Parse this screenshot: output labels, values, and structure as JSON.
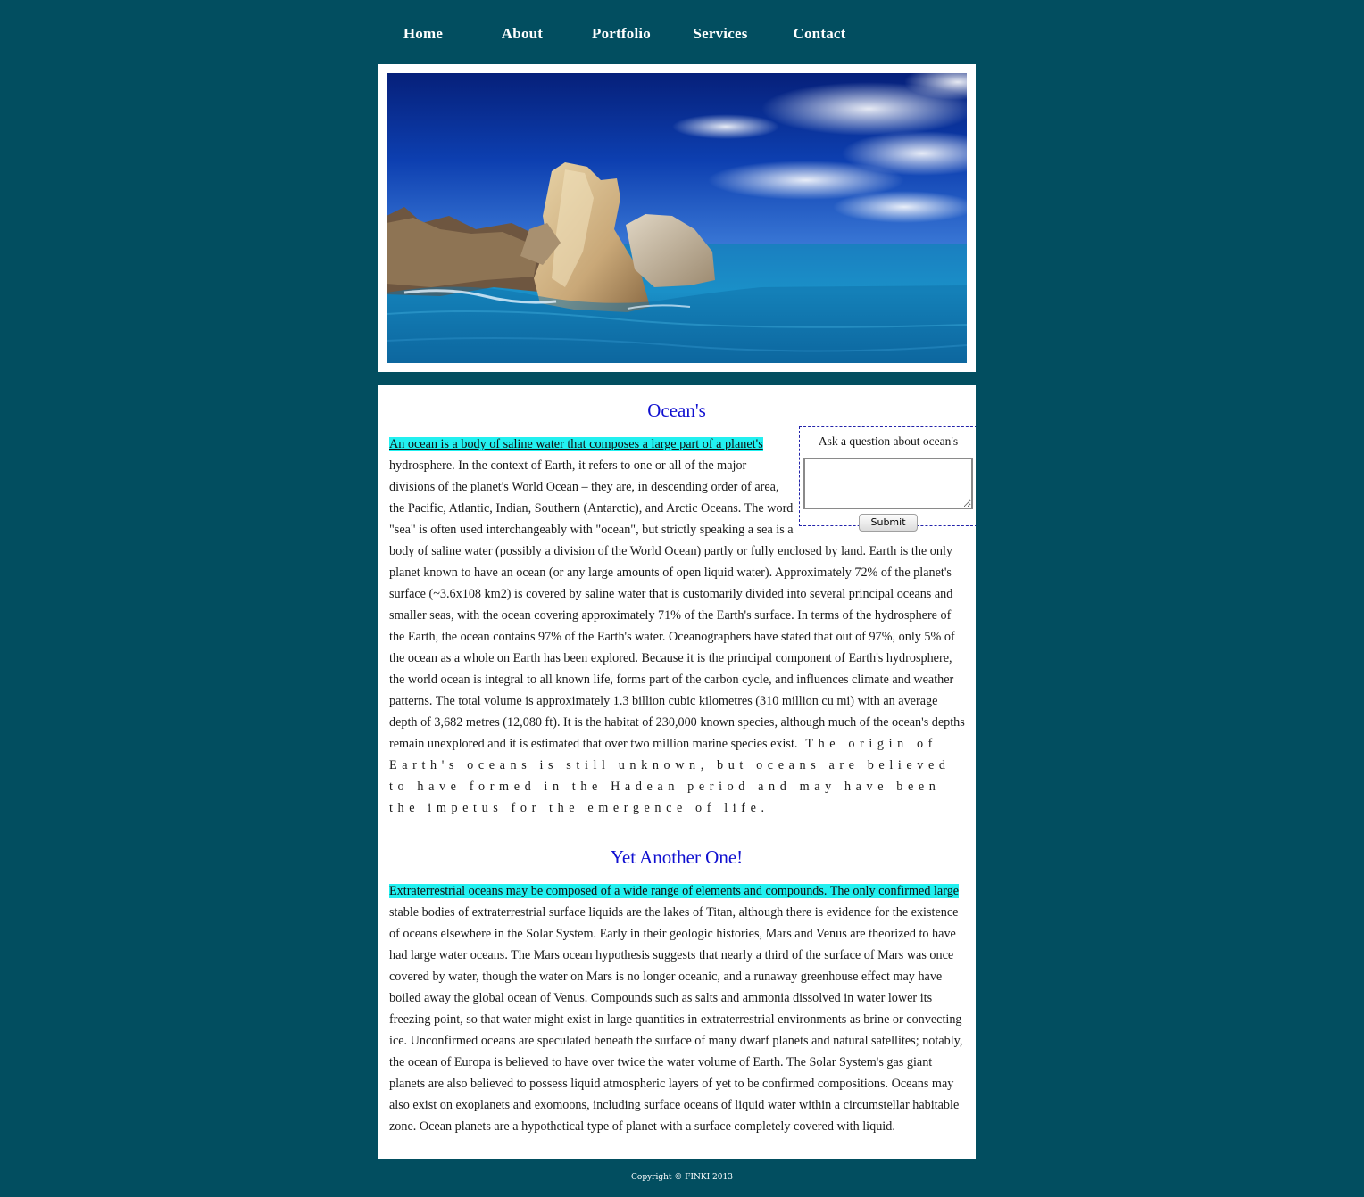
{
  "nav": {
    "items": [
      "Home",
      "About",
      "Portfolio",
      "Services",
      "Contact"
    ]
  },
  "hero": {
    "sky_color": "#0a2a8c",
    "sea_color": "#1570a8"
  },
  "section1": {
    "title": "Ocean's",
    "highlight": "An ocean is a body of saline water that composes a large part of a planet's",
    "body": " hydrosphere. In the context of Earth, it refers to one or all of the major divisions of the planet's World Ocean – they are, in descending order of area, the Pacific, Atlantic, Indian, Southern (Antarctic), and Arctic Oceans. The word \"sea\" is often used interchangeably with \"ocean\", but strictly speaking a sea is a body of saline water (possibly a division of the World Ocean) partly or fully enclosed by land. Earth is the only planet known to have an ocean (or any large amounts of open liquid water). Approximately 72% of the planet's surface (~3.6x108 km2) is covered by saline water that is customarily divided into several principal oceans and smaller seas, with the ocean covering approximately 71% of the Earth's surface. In terms of the hydrosphere of the Earth, the ocean contains 97% of the Earth's water. Oceanographers have stated that out of 97%, only 5% of the ocean as a whole on Earth has been explored. Because it is the principal component of Earth's hydrosphere, the world ocean is integral to all known life, forms part of the carbon cycle, and influences climate and weather patterns. The total volume is approximately 1.3 billion cubic kilometres (310 million cu mi) with an average depth of 3,682 metres (12,080 ft). It is the habitat of 230,000 known species, although much of the ocean's depths remain unexplored and it is estimated that over two million marine species exist.",
    "spaced": " The origin of Earth's oceans is still unknown, but oceans are believed to have formed in the Hadean period and may have been the impetus for the emergence of life."
  },
  "question_form": {
    "label": "Ask a question about ocean's",
    "textarea_value": "",
    "submit_label": "Submit"
  },
  "section2": {
    "title": "Yet Another One!",
    "highlight": "Extraterrestrial oceans may be composed of a wide range of elements and compounds. The only confirmed large",
    "body": " stable bodies of extraterrestrial surface liquids are the lakes of Titan, although there is evidence for the existence of oceans elsewhere in the Solar System. Early in their geologic histories, Mars and Venus are theorized to have had large water oceans. The Mars ocean hypothesis suggests that nearly a third of the surface of Mars was once covered by water, though the water on Mars is no longer oceanic, and a runaway greenhouse effect may have boiled away the global ocean of Venus. Compounds such as salts and ammonia dissolved in water lower its freezing point, so that water might exist in large quantities in extraterrestrial environments as brine or convecting ice. Unconfirmed oceans are speculated beneath the surface of many dwarf planets and natural satellites; notably, the ocean of Europa is believed to have over twice the water volume of Earth. The Solar System's gas giant planets are also believed to possess liquid atmospheric layers of yet to be confirmed compositions. Oceans may also exist on exoplanets and exomoons, including surface oceans of liquid water within a circumstellar habitable zone. Ocean planets are a hypothetical type of planet with a surface completely covered with liquid."
  },
  "footer": {
    "text": "Copyright © FINKI 2013"
  }
}
